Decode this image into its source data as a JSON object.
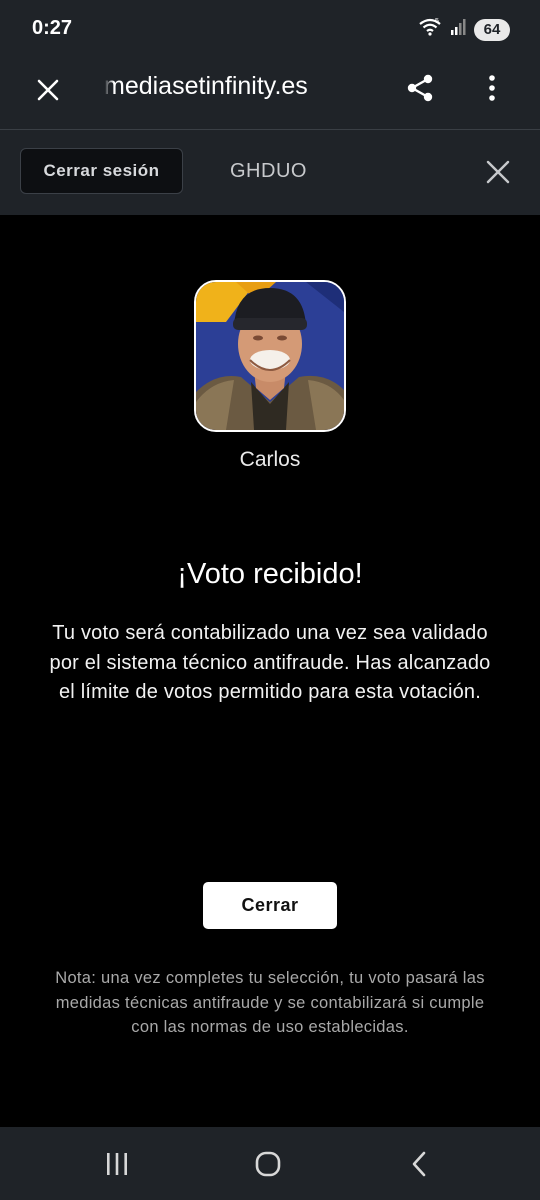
{
  "status_bar": {
    "time": "0:27",
    "battery": "64"
  },
  "browser": {
    "url": "mediasetinfinity.es"
  },
  "site_header": {
    "logout_label": "Cerrar sesión",
    "user_name": "GHDUO"
  },
  "vote": {
    "contestant_name": "Carlos",
    "title": "¡Voto recibido!",
    "message": "Tu voto será contabilizado una vez sea validado por el sistema técnico antifraude. Has alcanzado el límite de votos permitido para esta votación.",
    "close_label": "Cerrar",
    "note": "Nota: una vez completes tu selección, tu voto pasará las medidas técnicas antifraude y se contabilizará si cumple con las normas de uso establecidas."
  },
  "icons": {
    "wifi": "wifi-icon",
    "signal": "signal-icon",
    "browser_close": "close-icon",
    "share": "share-icon",
    "menu": "more-vert-icon",
    "header_close": "close-icon",
    "nav_recents": "recent-apps-icon",
    "nav_home": "home-icon",
    "nav_back": "back-icon"
  },
  "colors": {
    "chrome_bg": "#1f2328",
    "page_bg": "#000000",
    "button_bg": "#ffffff",
    "note_text": "#a9a9a9"
  }
}
